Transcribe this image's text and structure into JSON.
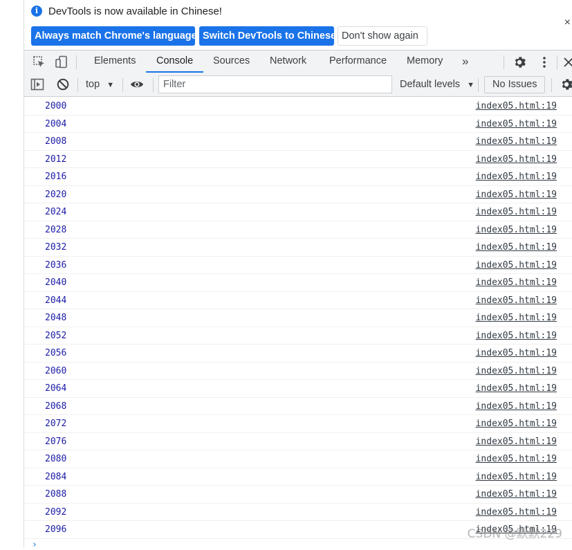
{
  "infobar": {
    "message": "DevTools is now available in Chinese!",
    "buttons": {
      "always_match": "Always match Chrome's language",
      "switch": "Switch DevTools to Chinese",
      "dont_show": "Don't show again"
    },
    "close": "×"
  },
  "tabs": {
    "items": [
      "Elements",
      "Console",
      "Sources",
      "Network",
      "Performance",
      "Memory"
    ],
    "active": "Console",
    "more": "»"
  },
  "toolbar": {
    "context": "top",
    "filter_placeholder": "Filter",
    "levels": "Default levels",
    "issues": "No Issues"
  },
  "console": {
    "messages": [
      {
        "value": "2000",
        "source": "index05.html:19"
      },
      {
        "value": "2004",
        "source": "index05.html:19"
      },
      {
        "value": "2008",
        "source": "index05.html:19"
      },
      {
        "value": "2012",
        "source": "index05.html:19"
      },
      {
        "value": "2016",
        "source": "index05.html:19"
      },
      {
        "value": "2020",
        "source": "index05.html:19"
      },
      {
        "value": "2024",
        "source": "index05.html:19"
      },
      {
        "value": "2028",
        "source": "index05.html:19"
      },
      {
        "value": "2032",
        "source": "index05.html:19"
      },
      {
        "value": "2036",
        "source": "index05.html:19"
      },
      {
        "value": "2040",
        "source": "index05.html:19"
      },
      {
        "value": "2044",
        "source": "index05.html:19"
      },
      {
        "value": "2048",
        "source": "index05.html:19"
      },
      {
        "value": "2052",
        "source": "index05.html:19"
      },
      {
        "value": "2056",
        "source": "index05.html:19"
      },
      {
        "value": "2060",
        "source": "index05.html:19"
      },
      {
        "value": "2064",
        "source": "index05.html:19"
      },
      {
        "value": "2068",
        "source": "index05.html:19"
      },
      {
        "value": "2072",
        "source": "index05.html:19"
      },
      {
        "value": "2076",
        "source": "index05.html:19"
      },
      {
        "value": "2080",
        "source": "index05.html:19"
      },
      {
        "value": "2084",
        "source": "index05.html:19"
      },
      {
        "value": "2088",
        "source": "index05.html:19"
      },
      {
        "value": "2092",
        "source": "index05.html:19"
      },
      {
        "value": "2096",
        "source": "index05.html:19"
      }
    ],
    "prompt": "›"
  },
  "watermark": "CSDN @默默229",
  "colors": {
    "accent": "#1a73e8",
    "log_value": "#1a1aa6",
    "toolbar_bg": "#f1f3f4"
  }
}
